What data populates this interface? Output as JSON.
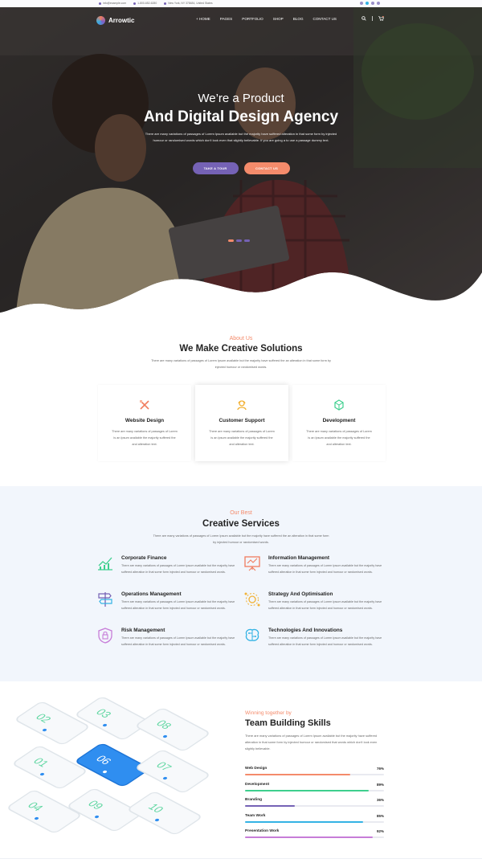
{
  "topbar": {
    "email": "info@example.com",
    "phone": "1-800-652-6280",
    "address": "New York, NY 378484, United States"
  },
  "nav": {
    "brand": "Arrowtic",
    "items": [
      "HOME",
      "PAGES",
      "PORTFOLIO",
      "SHOP",
      "BLOG",
      "CONTACT US"
    ]
  },
  "hero": {
    "line1": "We’re a Product",
    "line2": "And Digital Design Agency",
    "text": "There are many variations of passages of Lorem Ipsum available but the majority have suffered alteration in that some form by injected humour or randomised words which don't look even that slightly believable. If you are going a to use a passage dummy text.",
    "btn_tour": "TAKE A TOUR",
    "btn_contact": "CONTACT US"
  },
  "about": {
    "kicker": "About Us",
    "title": "We Make Creative Solutions",
    "text": "There are many variations of passages of Lorem Ipsum available but the majority have suffered the an alteration in that some form by injected humour or randomised words.",
    "cards": [
      {
        "title": "Website Design",
        "text": "There are many variations of passages of Lorem is an Ipsum available the majority suffered the and alteration text.",
        "icon": "pencil-ruler-icon"
      },
      {
        "title": "Customer Support",
        "text": "There are many variations of passages of Lorem is an Ipsum available the majority suffered the and alteration text.",
        "icon": "support-agent-icon"
      },
      {
        "title": "Development",
        "text": "There are many variations of passages of Lorem is an Ipsum available the majority suffered the and alteration text.",
        "icon": "cube-icon"
      }
    ]
  },
  "services": {
    "kicker": "Our Best",
    "title": "Creative Services",
    "text": "There are many variations of passages of Lorem Ipsum available but the majority have suffered the an alteration in that some form by injected humour or randomised words.",
    "items": [
      {
        "title": "Corporate Finance",
        "text": "There are many variations of passages of Lorem Ipsum available but the majority have suffered alteration in that some form injected and humour or randomised words.",
        "icon": "finance-chart-icon"
      },
      {
        "title": "Information Management",
        "text": "There are many variations of passages of Lorem Ipsum available but the majority have suffered alteration in that some form injected and humour or randomised words.",
        "icon": "presentation-board-icon"
      },
      {
        "title": "Operations Management",
        "text": "There are many variations of passages of Lorem Ipsum available but the majority have suffered alteration in that some form injected and humour or randomised words.",
        "icon": "signpost-icon"
      },
      {
        "title": "Strategy And Optimisation",
        "text": "There are many variations of passages of Lorem Ipsum available but the majority have suffered alteration in that some form injected and humour or randomised words.",
        "icon": "gear-strategy-icon"
      },
      {
        "title": "Risk Management",
        "text": "There are many variations of passages of Lorem Ipsum available but the majority have suffered alteration in that some form injected and humour or randomised words.",
        "icon": "shield-lock-icon"
      },
      {
        "title": "Technologies And Innovations",
        "text": "There are many variations of passages of Lorem Ipsum available but the majority have suffered alteration in that some form injected and humour or randomised words.",
        "icon": "brain-circuit-icon"
      }
    ]
  },
  "skills": {
    "kicker": "Winning together by",
    "title": "Team Building Skills",
    "text": "There are many variations of passages of Lorem Ipsum available but the majority have suffered alteration in that some form by injected humour or randomised that words which don't look even slightly believable.",
    "bars": [
      {
        "label": "Web Design",
        "pct": "76%",
        "value": 76,
        "color": "#f48b6b"
      },
      {
        "label": "Development",
        "pct": "89%",
        "value": 89,
        "color": "#3ecf8e"
      },
      {
        "label": "Branding",
        "pct": "36%",
        "value": 36,
        "color": "#7562b5"
      },
      {
        "label": "Team Work",
        "pct": "85%",
        "value": 85,
        "color": "#34b3e4"
      },
      {
        "label": "Presentation Work",
        "pct": "92%",
        "value": 92,
        "color": "#c77dd8"
      }
    ]
  },
  "phones": {
    "labels": [
      "02",
      "03",
      "08",
      "01",
      "06",
      "07",
      "04",
      "09",
      "10"
    ]
  },
  "colors": {
    "purple": "#7562b5",
    "orange": "#f48b6b"
  }
}
